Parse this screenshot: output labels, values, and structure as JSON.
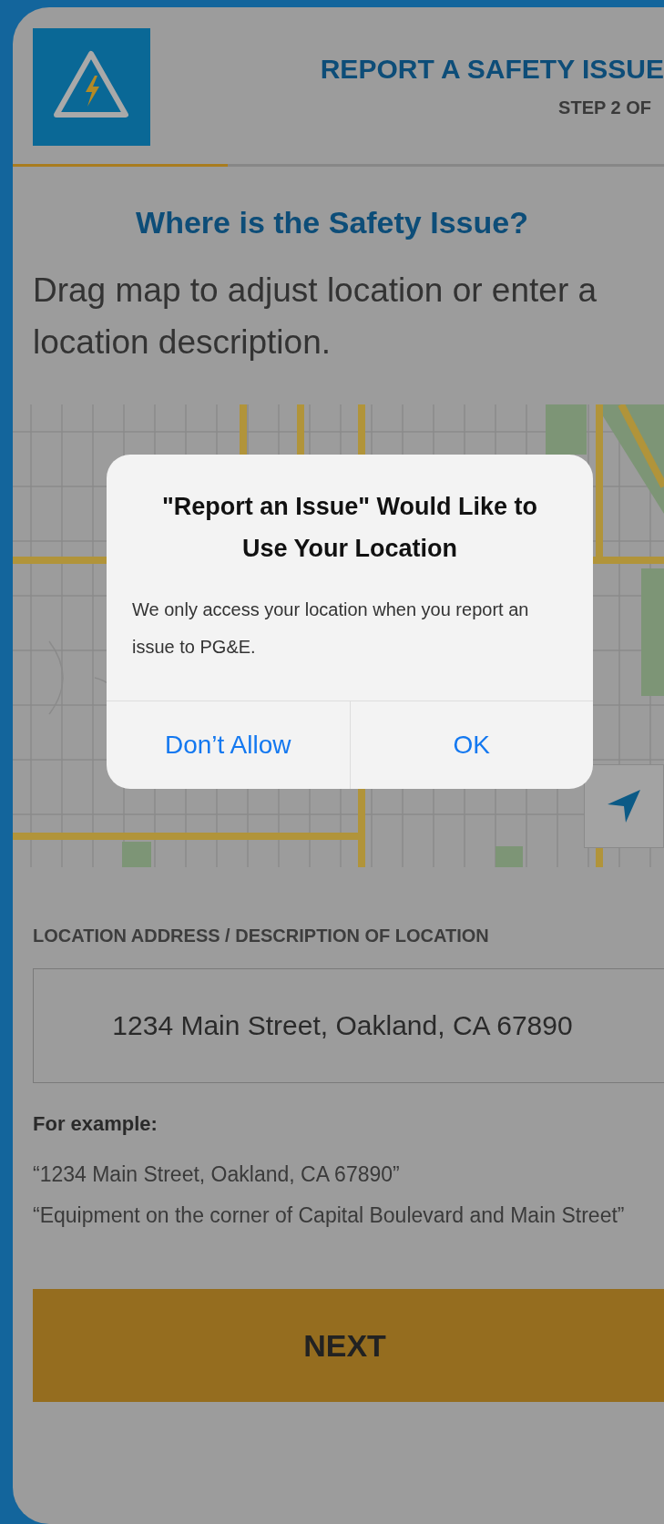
{
  "header": {
    "title": "REPORT A SAFETY ISSUE",
    "step": "STEP 2 OF",
    "progress": {
      "level": 0.33
    }
  },
  "heading": "Where is the Safety Issue?",
  "instructions": "Drag map to adjust location or enter a location description.",
  "dialog": {
    "title": "\"Report an Issue\" Would Like to Use Your Location",
    "message": "We only access your location when you report an issue to PG&E.",
    "buttons": [
      "Don’t Allow",
      "OK"
    ]
  },
  "location_field": {
    "label": "LOCATION ADDRESS / DESCRIPTION OF LOCATION",
    "value": "1234 Main Street, Oakland, CA 67890"
  },
  "examples": {
    "label": "For example:",
    "items": [
      "“1234 Main Street, Oakland, CA 67890”",
      "“Equipment on the corner of Capital Boulevard and Main Street”"
    ]
  },
  "next_button": "NEXT"
}
